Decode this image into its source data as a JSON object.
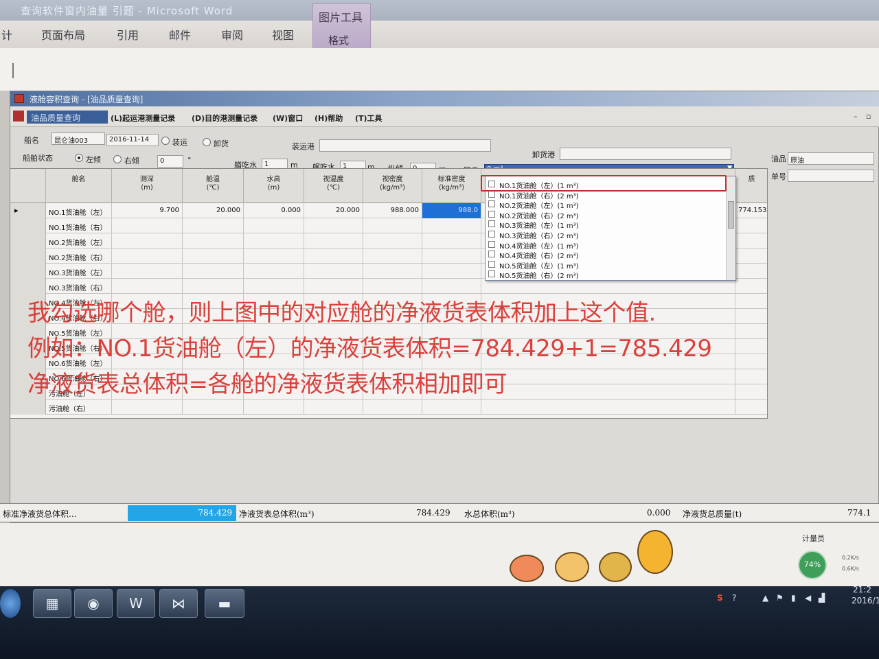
{
  "word": {
    "title": "查询软件窗内油量 引题 - Microsoft Word",
    "tabs": [
      "计",
      "页面布局",
      "引用",
      "邮件",
      "审阅",
      "视图"
    ],
    "picture_tools": "图片工具",
    "format_tab": "格式"
  },
  "app": {
    "title": "液舱容积查询 - [油品质量查询]",
    "menu": {
      "active": "油品质量查询",
      "items": [
        "(L)起运港测量记录",
        "(D)目的港测量记录",
        "(W)窗口",
        "(H)帮助",
        "(T)工具"
      ]
    },
    "form": {
      "ship_name_label": "船名",
      "ship_name_value": "昆仑油003",
      "date_value": "2016-11-14",
      "loading_label": "装运",
      "unloading_label": "卸货",
      "loading_port_label": "装运港",
      "unloading_port_label": "卸货港",
      "ship_status_label": "船舶状态",
      "left_list_label": "左倾",
      "right_list_label": "右倾",
      "list_value": "0",
      "degree_unit": "°",
      "fore_draft_label": "艏吃水",
      "fore_draft_value": "1",
      "aft_draft_label": "艉吃水",
      "aft_draft_value": "1",
      "trim_label": "纵倾",
      "trim_value": "0",
      "meter_unit": "m",
      "pipe_label": "管系",
      "pipe_value": "0 m³",
      "oil_type_label": "油品",
      "oil_type_value": "原油",
      "bill_label": "单号"
    },
    "grid": {
      "headers": [
        "舱名",
        "测深\n(m)",
        "舱温\n(℃)",
        "水高\n(m)",
        "视温度\n(℃)",
        "视密度\n(kg/m³)",
        "标准密度\n(kg/m³)"
      ],
      "extra_header": "质",
      "side_value": "774.153",
      "rows": [
        {
          "name": "NO.1货油舱（左）",
          "sounding": "9.700",
          "temp": "20.000",
          "water": "0.000",
          "view_temp": "20.000",
          "view_density": "988.000",
          "std_density": "988.0"
        },
        {
          "name": "NO.1货油舱（右）"
        },
        {
          "name": "NO.2货油舱（左）"
        },
        {
          "name": "NO.2货油舱（右）"
        },
        {
          "name": "NO.3货油舱（左）"
        },
        {
          "name": "NO.3货油舱（右）"
        },
        {
          "name": "NO.4货油舱（左）"
        },
        {
          "name": "NO.4货油舱（右）"
        },
        {
          "name": "NO.5货油舱（左）"
        },
        {
          "name": "NO.5货油舱（右）"
        },
        {
          "name": "NO.6货油舱（左）"
        },
        {
          "name": "NO.6货油舱（右）"
        },
        {
          "name": "污油舱（左）"
        },
        {
          "name": "污油舱（右）"
        }
      ]
    },
    "dropdown": {
      "items": [
        "NO.1货油舱（左）(1 m³)",
        "NO.1货油舱（右）(2 m³)",
        "NO.2货油舱（左）(1 m³)",
        "NO.2货油舱（右）(2 m³)",
        "NO.3货油舱（左）(1 m³)",
        "NO.3货油舱（右）(2 m³)",
        "NO.4货油舱（左）(1 m³)",
        "NO.4货油舱（右）(2 m³)",
        "NO.5货油舱（左）(1 m³)",
        "NO.5货油舱（右）(2 m³)"
      ]
    }
  },
  "annotation": {
    "line1": "我勾选哪个舱，则上图中的对应舱的净液货表体积加上这个值.",
    "line2": "例如：NO.1货油舱（左）的净液货表体积=784.429+1=785.429",
    "line3": "净液货表总体积=各舱的净液货表体积相加即可"
  },
  "status": {
    "std_total_label": "标准净液货总体积...",
    "std_total_value": "784.429",
    "net_total_label": "净液货表总体积(m³)",
    "net_total_value": "784.429",
    "water_label": "水总体积(m³)",
    "water_value": "0.000",
    "mass_label": "净液货总质量(t)",
    "mass_value": "774.1"
  },
  "lower": {
    "meter_label": "计量员",
    "net_percent": "74%",
    "net_up": "0.2K/s",
    "net_down": "0.6K/s"
  },
  "taskbar": {
    "time": "21:2",
    "date": "2016/1",
    "ime": "S"
  }
}
